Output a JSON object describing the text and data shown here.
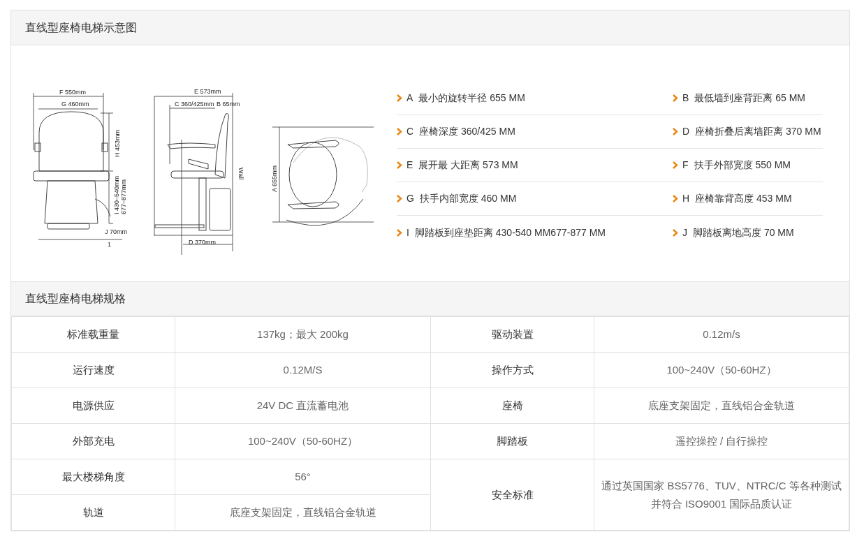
{
  "diagram_section": {
    "title": "直线型座椅电梯示意图",
    "drawings": [
      {
        "kind": "front",
        "labels": [
          "F 550mm",
          "G 460mm",
          "H 453mm",
          "I 430–540mm",
          "677–877mm",
          "J 70mm",
          "1"
        ]
      },
      {
        "kind": "side",
        "labels": [
          "E 573mm",
          "C 360/425mm",
          "B 65mm",
          "Wall",
          "D 370mm"
        ]
      },
      {
        "kind": "top",
        "labels": [
          "A 655mm"
        ]
      }
    ],
    "specs": [
      {
        "letter": "A",
        "text": "最小的旋转半径 655 MM"
      },
      {
        "letter": "B",
        "text": "最低墙到座背距离 65 MM"
      },
      {
        "letter": "C",
        "text": "座椅深度 360/425 MM"
      },
      {
        "letter": "D",
        "text": "座椅折叠后离墙距离 370 MM"
      },
      {
        "letter": "E",
        "text": "展开最 大距离 573 MM"
      },
      {
        "letter": "F",
        "text": "扶手外部宽度 550 MM"
      },
      {
        "letter": "G",
        "text": "扶手内部宽度 460 MM"
      },
      {
        "letter": "H",
        "text": "座椅靠背高度 453 MM"
      },
      {
        "letter": "I",
        "text": "脚踏板到座垫距离 430-540 MM677-877 MM"
      },
      {
        "letter": "J",
        "text": "脚踏板离地高度 70 MM"
      }
    ]
  },
  "spec_section": {
    "title": "直线型座椅电梯规格",
    "rows": [
      {
        "cells": [
          {
            "text": "标准载重量"
          },
          {
            "text": "137kg；最大 200kg"
          },
          {
            "text": "驱动装置"
          },
          {
            "text": "0.12m/s"
          }
        ]
      },
      {
        "cells": [
          {
            "text": "运行速度"
          },
          {
            "text": "0.12M/S"
          },
          {
            "text": "操作方式"
          },
          {
            "text": "100~240V（50-60HZ）"
          }
        ]
      },
      {
        "cells": [
          {
            "text": "电源供应"
          },
          {
            "text": "24V DC 直流蓄电池"
          },
          {
            "text": "座椅"
          },
          {
            "text": "底座支架固定，直线铝合金轨道"
          }
        ]
      },
      {
        "cells": [
          {
            "text": "外部充电"
          },
          {
            "text": "100~240V（50-60HZ）"
          },
          {
            "text": "脚踏板"
          },
          {
            "text": "遥控操控 / 自行操控"
          }
        ]
      },
      {
        "cells": [
          {
            "text": "最大楼梯角度"
          },
          {
            "text": "56°"
          },
          {
            "text": "安全标准",
            "rowspan": 2
          },
          {
            "text": "通过英国国家 BS5776、TUV、NTRC/C 等各种测试并符合 ISO9001 国际品质认证",
            "rowspan": 2
          }
        ]
      },
      {
        "cells": [
          {
            "text": "轨道"
          },
          {
            "text": "底座支架固定，直线铝合金轨道"
          }
        ]
      }
    ]
  }
}
